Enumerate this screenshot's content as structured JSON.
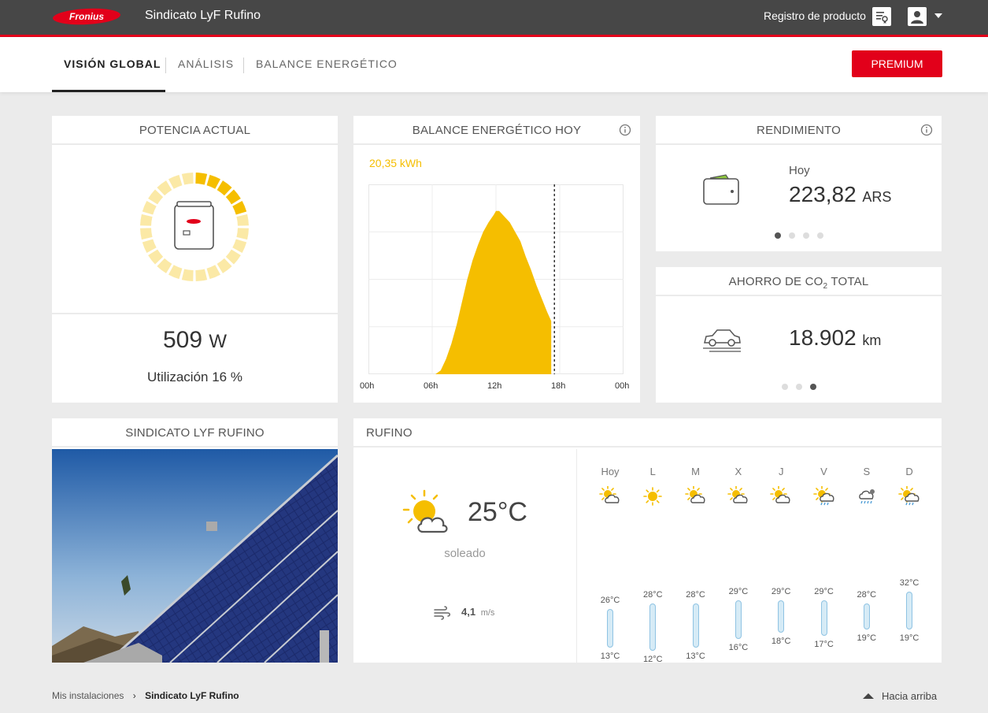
{
  "header": {
    "logo_text": "Fronius",
    "site_title": "Sindicato LyF Rufino",
    "registration_label": "Registro de producto"
  },
  "nav": {
    "tabs": [
      "VISIÓN GLOBAL",
      "ANÁLISIS",
      "BALANCE ENERGÉTICO"
    ],
    "active_tab": "VISIÓN GLOBAL",
    "premium_label": "PREMIUM"
  },
  "colors": {
    "brand": "#e2001a",
    "solar": "#f5be00",
    "solar_light": "#fbe9a6"
  },
  "power": {
    "title": "POTENCIA ACTUAL",
    "value": "509",
    "unit": "W",
    "utilization": "Utilización 16 %",
    "utilization_fraction": 0.16
  },
  "balance": {
    "title": "BALANCE ENERGÉTICO HOY",
    "energy": "20,35 kWh"
  },
  "chart_data": {
    "type": "area",
    "title": "BALANCE ENERGÉTICO HOY",
    "xlabel": "",
    "ylabel": "",
    "x_ticks": [
      "00h",
      "06h",
      "12h",
      "18h",
      "00h"
    ],
    "xlim": [
      0,
      24
    ],
    "current_time_hour": 17.5,
    "series": [
      {
        "x": [
          6.3,
          6.8,
          7.3,
          7.8,
          8.3,
          8.8,
          9.3,
          9.8,
          10.3,
          10.8,
          11.3,
          11.8,
          12.0,
          12.3,
          12.8,
          13.3,
          13.8,
          14.3,
          14.8,
          15.3,
          15.8,
          16.3,
          16.8,
          17.2
        ],
        "y": [
          0.0,
          0.02,
          0.08,
          0.16,
          0.26,
          0.38,
          0.5,
          0.6,
          0.68,
          0.75,
          0.8,
          0.84,
          0.86,
          0.86,
          0.83,
          0.8,
          0.75,
          0.7,
          0.62,
          0.55,
          0.47,
          0.4,
          0.33,
          0.28
        ]
      }
    ]
  },
  "rendimiento": {
    "title": "RENDIMIENTO",
    "label": "Hoy",
    "value": "223,82",
    "currency": "ARS"
  },
  "co2": {
    "title_prefix": "AHORRO DE CO",
    "title_sub": "2",
    "title_suffix": " TOTAL",
    "value": "18.902",
    "unit": "km"
  },
  "photo": {
    "title": "SINDICATO LYF RUFINO"
  },
  "weather": {
    "title": "RUFINO",
    "current_temp": "25°C",
    "condition": "soleado",
    "wind_value": "4,1",
    "wind_unit": "m/s",
    "forecast": [
      {
        "day": "Hoy",
        "icon": "partly-cloudy-icon",
        "max": "26°C",
        "min": "13°C"
      },
      {
        "day": "L",
        "icon": "sun-icon",
        "max": "28°C",
        "min": "12°C"
      },
      {
        "day": "M",
        "icon": "partly-cloudy-icon",
        "max": "28°C",
        "min": "13°C"
      },
      {
        "day": "X",
        "icon": "partly-cloudy-icon",
        "max": "29°C",
        "min": "16°C"
      },
      {
        "day": "J",
        "icon": "partly-cloudy-icon",
        "max": "29°C",
        "min": "18°C"
      },
      {
        "day": "V",
        "icon": "sun-rain-icon",
        "max": "29°C",
        "min": "17°C"
      },
      {
        "day": "S",
        "icon": "cloud-rain-icon",
        "max": "28°C",
        "min": "19°C"
      },
      {
        "day": "D",
        "icon": "sun-rain-icon",
        "max": "32°C",
        "min": "19°C"
      }
    ]
  },
  "footer": {
    "breadcrumb_root": "Mis instalaciones",
    "breadcrumb_sep": "›",
    "breadcrumb_current": "Sindicato LyF Rufino",
    "to_top": "Hacia arriba"
  }
}
